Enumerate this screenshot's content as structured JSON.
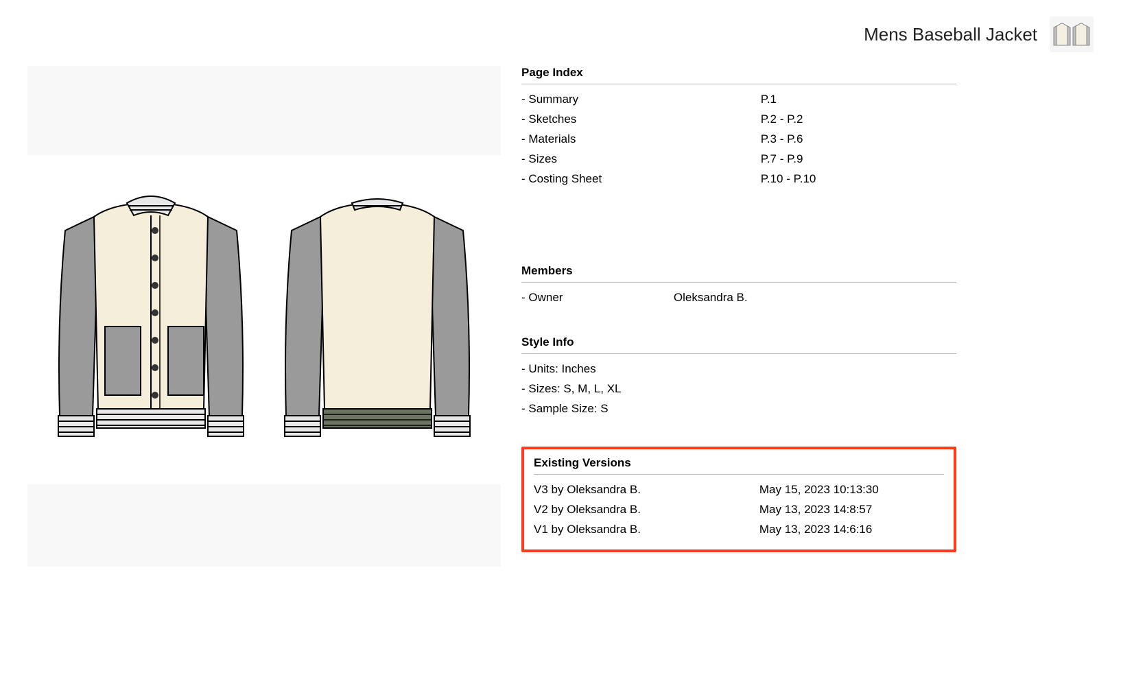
{
  "header": {
    "title": "Mens Baseball Jacket"
  },
  "page_index": {
    "title": "Page Index",
    "items": [
      {
        "label": "- Summary",
        "pages": "P.1"
      },
      {
        "label": "- Sketches",
        "pages": "P.2 - P.2"
      },
      {
        "label": "- Materials",
        "pages": "P.3 - P.6"
      },
      {
        "label": "- Sizes",
        "pages": "P.7 - P.9"
      },
      {
        "label": "- Costing Sheet",
        "pages": "P.10 - P.10"
      }
    ]
  },
  "members": {
    "title": "Members",
    "items": [
      {
        "label": "- Owner",
        "value": "Oleksandra B."
      }
    ]
  },
  "style_info": {
    "title": "Style Info",
    "items": [
      {
        "label": "- Units: Inches"
      },
      {
        "label": "- Sizes: S, M, L, XL"
      },
      {
        "label": "- Sample Size: S"
      }
    ]
  },
  "versions": {
    "title": "Existing Versions",
    "items": [
      {
        "label": "V3 by Oleksandra B.",
        "date": "May 15, 2023 10:13:30"
      },
      {
        "label": "V2 by Oleksandra B.",
        "date": "May 13, 2023 14:8:57"
      },
      {
        "label": "V1 by Oleksandra B.",
        "date": "May 13, 2023 14:6:16"
      }
    ]
  }
}
